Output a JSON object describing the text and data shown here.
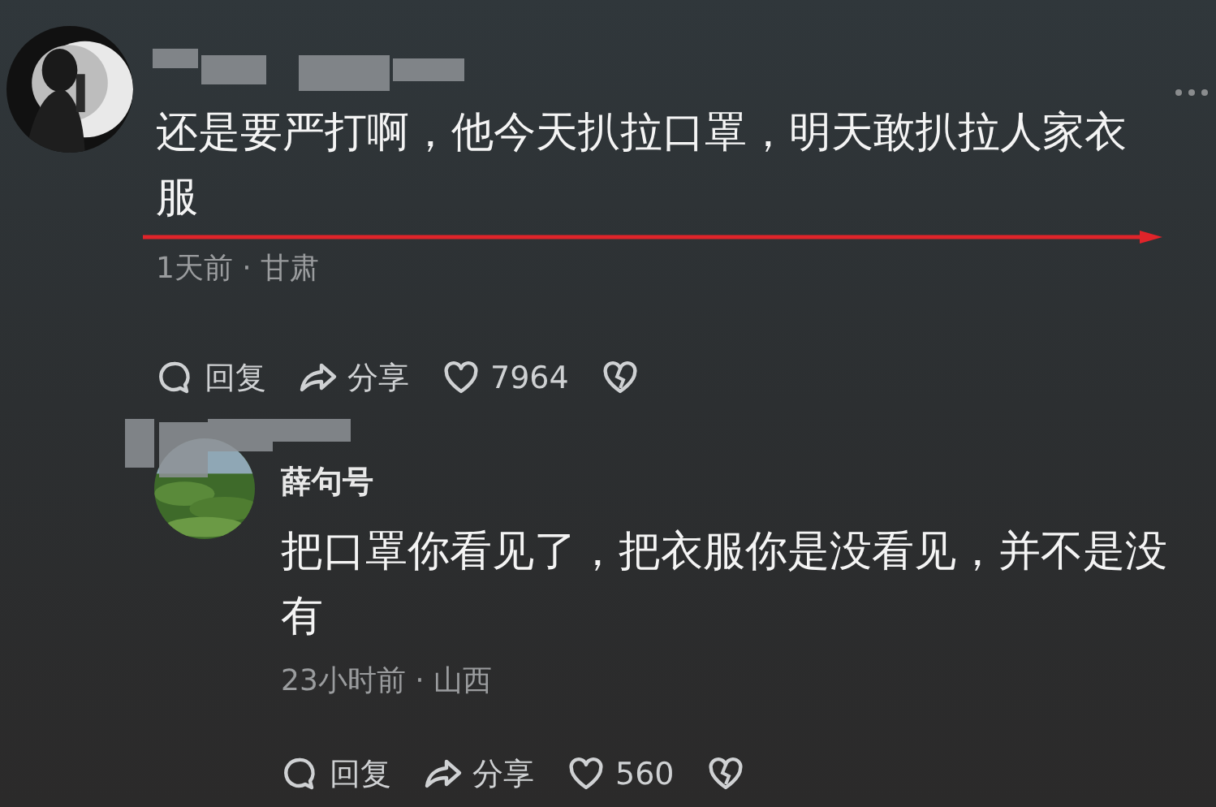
{
  "comments": [
    {
      "name_redacted": true,
      "text": "还是要严打啊，他今天扒拉口罩，明天敢扒拉人家衣服",
      "underline_arrow": true,
      "meta": "1天前 · 甘肃",
      "reply_label": "回复",
      "share_label": "分享",
      "likes": "7964",
      "more": true,
      "replies": [
        {
          "name_redacted": true,
          "author": "薛句号",
          "text": "把口罩你看见了，把衣服你是没看见，并不是没有",
          "underline_arrow": false,
          "meta": "23小时前 · 山西",
          "reply_label": "回复",
          "share_label": "分享",
          "likes": "560",
          "more": false
        }
      ]
    }
  ]
}
